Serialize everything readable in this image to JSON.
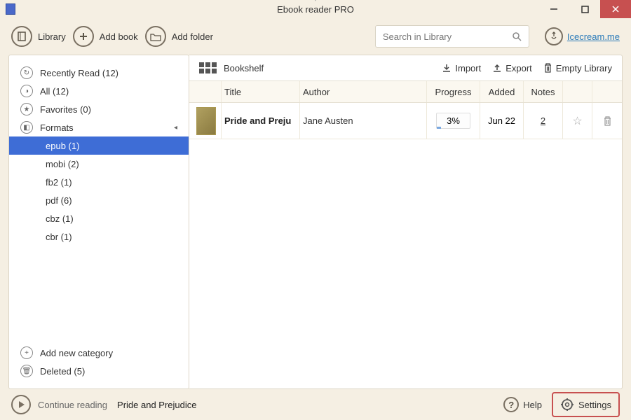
{
  "window": {
    "title": "Ebook reader PRO"
  },
  "toolbar": {
    "library": "Library",
    "add_book": "Add book",
    "add_folder": "Add folder",
    "search_placeholder": "Search in Library",
    "user_link": "Icecream.me"
  },
  "sidebar": {
    "items": [
      {
        "icon": "recent",
        "label": "Recently Read (12)"
      },
      {
        "icon": "all",
        "label": "All (12)"
      },
      {
        "icon": "fav",
        "label": "Favorites (0)"
      },
      {
        "icon": "formats",
        "label": "Formats",
        "expandable": true
      }
    ],
    "formats": [
      {
        "label": "epub (1)",
        "selected": true
      },
      {
        "label": "mobi (2)"
      },
      {
        "label": "fb2 (1)"
      },
      {
        "label": "pdf (6)"
      },
      {
        "label": "cbz (1)"
      },
      {
        "label": "cbr (1)"
      }
    ],
    "add_category": "Add new category",
    "deleted": "Deleted (5)"
  },
  "shelf": {
    "label": "Bookshelf",
    "import": "Import",
    "export": "Export",
    "empty": "Empty Library",
    "columns": {
      "title": "Title",
      "author": "Author",
      "progress": "Progress",
      "added": "Added",
      "notes": "Notes"
    },
    "rows": [
      {
        "title": "Pride and Preju",
        "author": "Jane Austen",
        "progress": "3%",
        "added": "Jun 22",
        "notes": "2"
      }
    ]
  },
  "bottom": {
    "continue_label": "Continue reading",
    "continue_title": "Pride and Prejudice",
    "help": "Help",
    "settings": "Settings"
  }
}
